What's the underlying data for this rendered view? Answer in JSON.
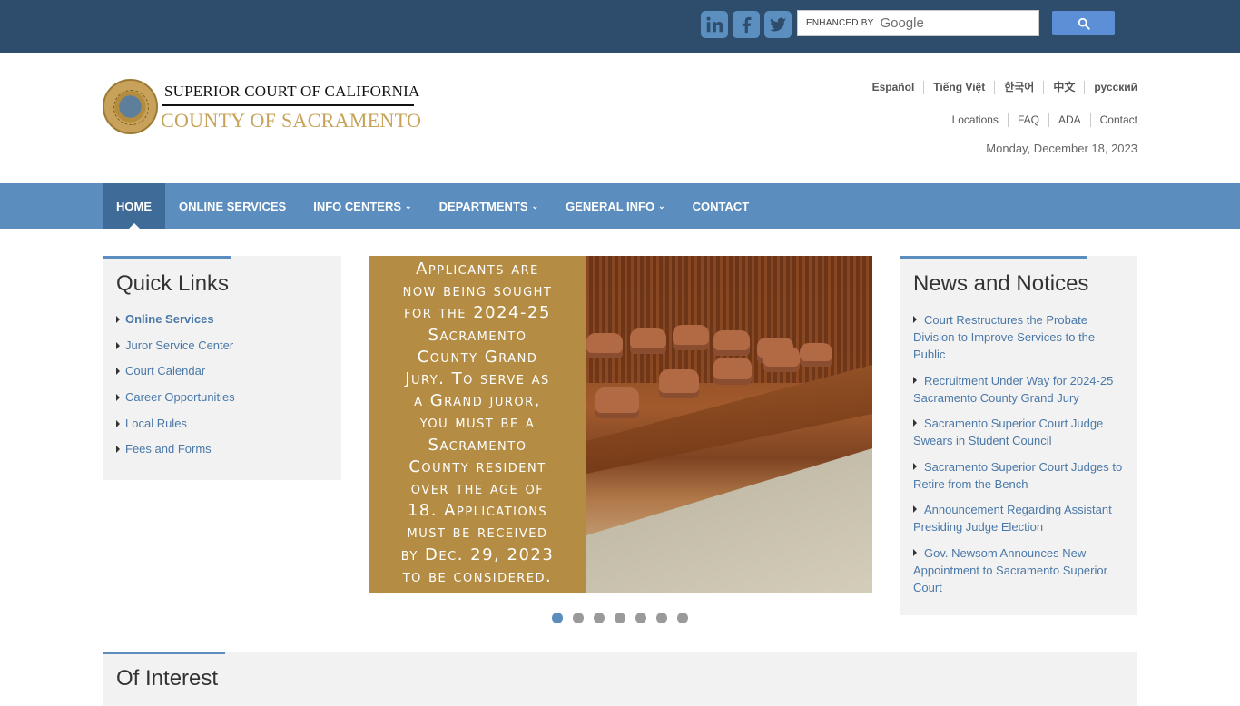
{
  "topbar": {
    "social": [
      {
        "name": "linkedin",
        "glyph": "in"
      },
      {
        "name": "facebook",
        "glyph": "f"
      },
      {
        "name": "twitter",
        "glyph": "t"
      }
    ],
    "search": {
      "enhanced_by": "ENHANCED BY",
      "brand": "Google"
    }
  },
  "header": {
    "court_title": "SUPERIOR COURT OF CALIFORNIA",
    "county_title": "COUNTY OF SACRAMENTO",
    "languages": [
      "Español",
      "Tiếng Việt",
      "한국어",
      "中文",
      "русский"
    ],
    "utility_links": [
      "Locations",
      "FAQ",
      "ADA",
      "Contact"
    ],
    "date": "Monday, December 18, 2023"
  },
  "nav": {
    "items": [
      {
        "label": "HOME",
        "active": true,
        "dropdown": false
      },
      {
        "label": "ONLINE SERVICES",
        "active": false,
        "dropdown": false
      },
      {
        "label": "INFO CENTERS",
        "active": false,
        "dropdown": true
      },
      {
        "label": "DEPARTMENTS",
        "active": false,
        "dropdown": true
      },
      {
        "label": "GENERAL INFO",
        "active": false,
        "dropdown": true
      },
      {
        "label": "CONTACT",
        "active": false,
        "dropdown": false
      }
    ]
  },
  "quick_links": {
    "title": "Quick Links",
    "items": [
      "Online Services",
      "Juror Service Center",
      "Court Calendar",
      "Career Opportunities",
      "Local Rules",
      "Fees and Forms"
    ]
  },
  "slider": {
    "lines": [
      "Applicants are",
      "now being sought",
      "for the 2024-25",
      "Sacramento",
      "County Grand",
      "Jury. To serve as",
      "a Grand juror,",
      "you must be a",
      "Sacramento",
      "County resident",
      "over the age of",
      "18. Applications",
      "must be received",
      "by Dec. 29, 2023",
      "to be considered."
    ],
    "dot_count": 7,
    "active_dot": 0
  },
  "news": {
    "title": "News and Notices",
    "items": [
      "Court Restructures the Probate Division to Improve Services to the Public",
      "Recruitment Under Way for 2024-25 Sacramento County Grand Jury",
      "Sacramento Superior Court Judge Swears in Student Council",
      "Sacramento Superior Court Judges to Retire from the Bench",
      "Announcement Regarding Assistant Presiding Judge Election",
      "Gov. Newsom Announces New Appointment to Sacramento Superior Court"
    ]
  },
  "of_interest": {
    "title": "Of Interest"
  },
  "colors": {
    "topbar": "#2e4d6d",
    "nav": "#5b8dbe",
    "nav_active": "#3f6b98",
    "link": "#4a78a8",
    "gold": "#c7a258"
  }
}
